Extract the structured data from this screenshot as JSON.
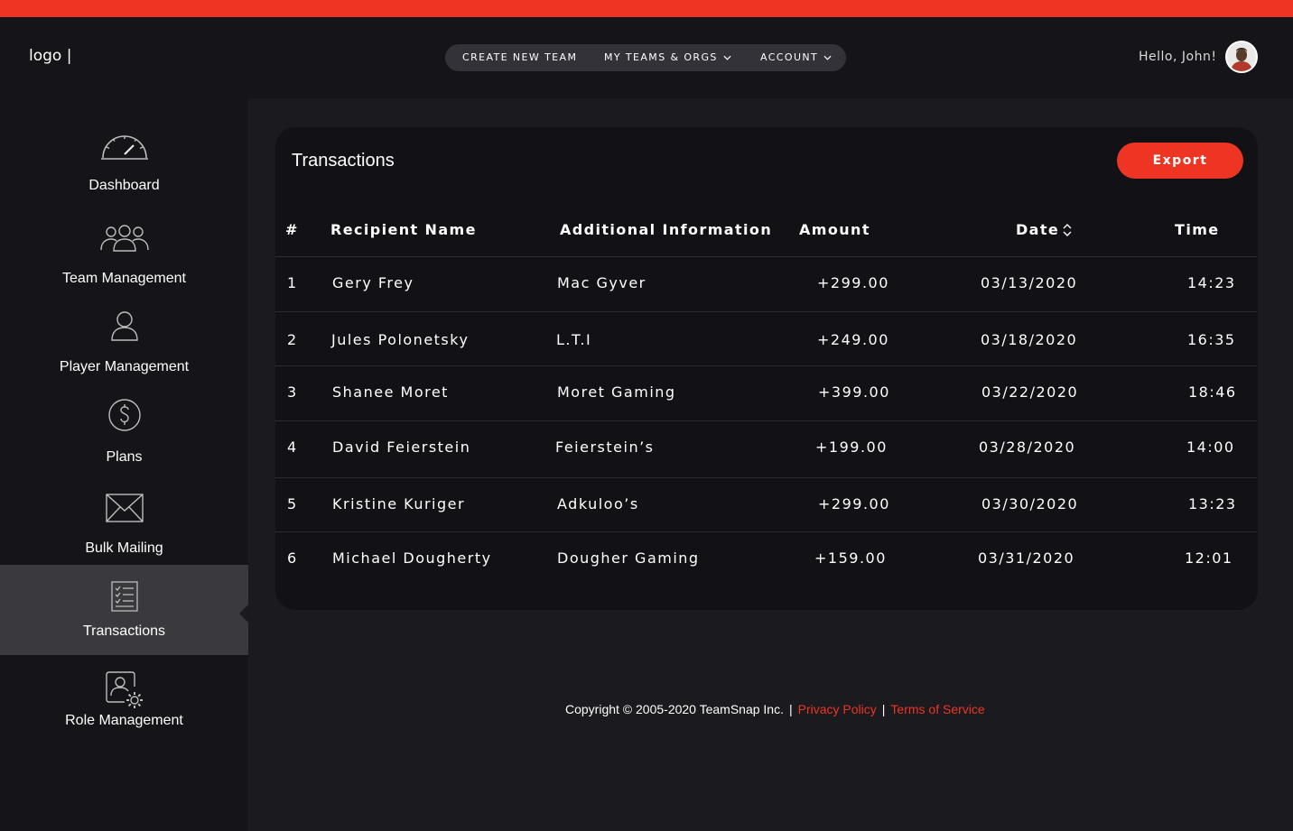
{
  "header": {
    "logo": "logo |",
    "nav": [
      {
        "label": "CREATE NEW TEAM",
        "dropdown": false
      },
      {
        "label": "MY TEAMS & ORGS",
        "dropdown": true
      },
      {
        "label": "ACCOUNT",
        "dropdown": true
      }
    ],
    "greeting": "Hello, John!"
  },
  "sidebar": {
    "items": [
      {
        "label": "Dashboard",
        "icon": "speedometer-icon"
      },
      {
        "label": "Team Management",
        "icon": "team-icon"
      },
      {
        "label": "Player Management",
        "icon": "user-icon"
      },
      {
        "label": "Plans",
        "icon": "dollar-icon"
      },
      {
        "label": "Bulk Mailing",
        "icon": "envelope-icon"
      },
      {
        "label": "Transactions",
        "icon": "checklist-icon",
        "active": true
      },
      {
        "label": "Role Management",
        "icon": "role-settings-icon"
      }
    ]
  },
  "transactions": {
    "title": "Transactions",
    "export_label": "Export",
    "columns": [
      "#",
      "Recipient Name",
      "Additional Information",
      "Amount",
      "Date",
      "Time"
    ],
    "rows": [
      {
        "num": "1",
        "name": "Gery Frey",
        "info": "Mac Gyver",
        "amount": "+299.00",
        "date": "03/13/2020",
        "time": "14:23"
      },
      {
        "num": "2",
        "name": "Jules Polonetsky",
        "info": "L.T.I",
        "amount": "+249.00",
        "date": "03/18/2020",
        "time": "16:35"
      },
      {
        "num": "3",
        "name": "Shanee Moret",
        "info": "Moret Gaming",
        "amount": "+399.00",
        "date": "03/22/2020",
        "time": "18:46"
      },
      {
        "num": "4",
        "name": "David Feierstein",
        "info": "Feierstein’s",
        "amount": "+199.00",
        "date": "03/28/2020",
        "time": "14:00"
      },
      {
        "num": "5",
        "name": "Kristine Kuriger",
        "info": "Adkuloo’s",
        "amount": "+299.00",
        "date": "03/30/2020",
        "time": "13:23"
      },
      {
        "num": "6",
        "name": "Michael Dougherty",
        "info": "Dougher Gaming",
        "amount": "+159.00",
        "date": "03/31/2020",
        "time": "12:01"
      }
    ]
  },
  "footer": {
    "copyright": "Copyright © 2005-2020 TeamSnap Inc.",
    "separator": "|",
    "privacy": "Privacy Policy",
    "terms": "Terms of Service"
  },
  "colors": {
    "accent": "#ee3524",
    "background": "#1b1a1e",
    "sidebar": "#151418",
    "card": "#121115",
    "active_item": "#3a393d"
  }
}
